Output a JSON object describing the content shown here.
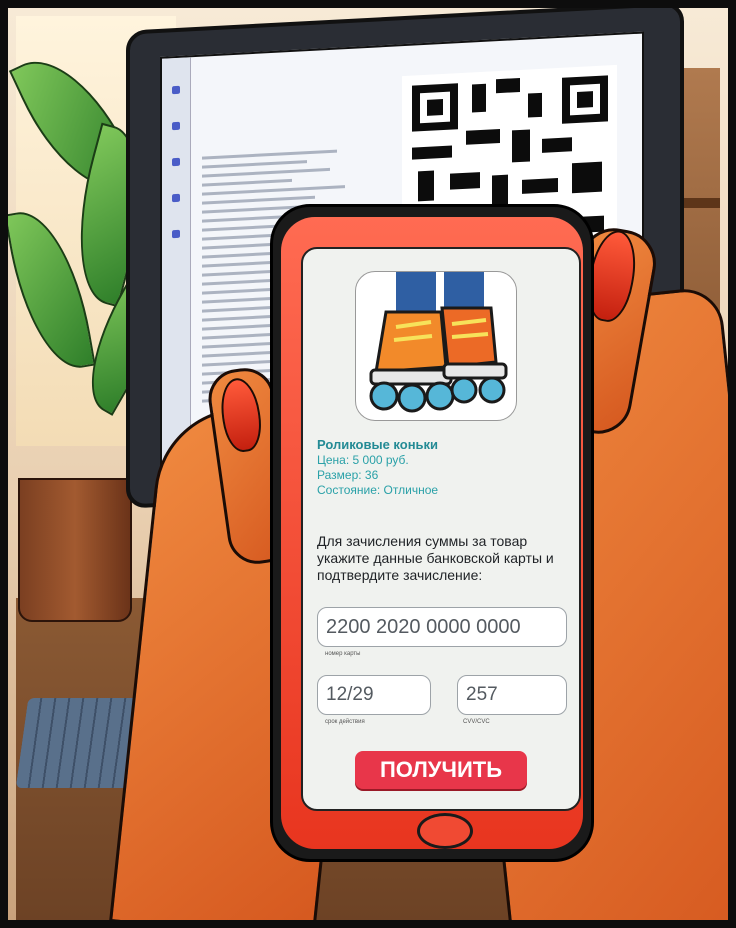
{
  "product": {
    "name": "Роликовые коньки",
    "price": "Цена: 5 000 руб.",
    "size": "Размер: 36",
    "condition": "Состояние: Отличное"
  },
  "instructions": "Для зачисления суммы за товар укажите данные банковской карты и подтвердите зачисление:",
  "card_number": {
    "value": "2200 2020 0000 0000",
    "label": "номер карты"
  },
  "expiry": {
    "value": "12/29",
    "label": "срок действия"
  },
  "cvv": {
    "value": "257",
    "label": "CVV/CVC"
  },
  "submit_label": "ПОЛУЧИТЬ",
  "colors": {
    "product_title": "#248b95",
    "product_details": "#2aa1a8",
    "button": "#e8364a",
    "phone_case": "#ff6b52"
  },
  "icons": {
    "product_image": "roller-skates-icon",
    "qr": "qr-code-icon"
  }
}
